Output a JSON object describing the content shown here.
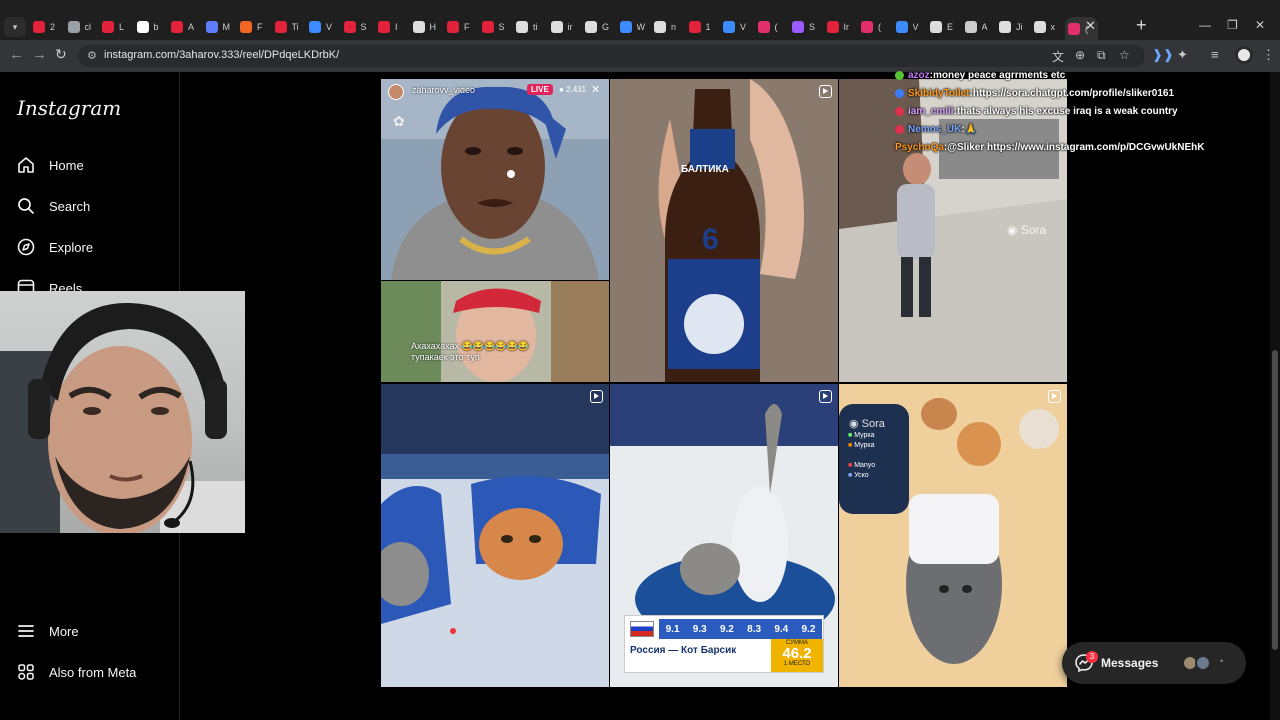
{
  "browser": {
    "tabs": [
      {
        "title": "2",
        "color": "#e3223c"
      },
      {
        "title": "cl",
        "color": "#9aa0a6"
      },
      {
        "title": "L",
        "color": "#e3223c"
      },
      {
        "title": "b",
        "color": "#ffffff"
      },
      {
        "title": "A",
        "color": "#e3223c"
      },
      {
        "title": "M",
        "color": "#5c7cfa"
      },
      {
        "title": "F",
        "color": "#f26522"
      },
      {
        "title": "Ti",
        "color": "#e3223c"
      },
      {
        "title": "V",
        "color": "#3d8bff"
      },
      {
        "title": "S",
        "color": "#e3223c"
      },
      {
        "title": "I",
        "color": "#e3223c"
      },
      {
        "title": "H",
        "color": "#dddddd"
      },
      {
        "title": "F",
        "color": "#e3223c"
      },
      {
        "title": "S",
        "color": "#e3223c"
      },
      {
        "title": "ti",
        "color": "#dddddd"
      },
      {
        "title": "ir",
        "color": "#dddddd"
      },
      {
        "title": "G",
        "color": "#dddddd"
      },
      {
        "title": "W",
        "color": "#3d8bff"
      },
      {
        "title": "n",
        "color": "#dddddd"
      },
      {
        "title": "1",
        "color": "#e3223c"
      },
      {
        "title": "V",
        "color": "#3d8bff"
      },
      {
        "title": "(",
        "color": "#e1306c"
      },
      {
        "title": "S",
        "color": "#9b59ff"
      },
      {
        "title": "Ir",
        "color": "#e3223c"
      },
      {
        "title": "(",
        "color": "#e1306c"
      },
      {
        "title": "V",
        "color": "#3d8bff"
      },
      {
        "title": "E",
        "color": "#dddddd"
      },
      {
        "title": "A",
        "color": "#cccccc"
      },
      {
        "title": "Ji",
        "color": "#dddddd"
      },
      {
        "title": "x",
        "color": "#dddddd"
      },
      {
        "title": "(",
        "color": "#e1306c"
      }
    ],
    "new_tab": "+",
    "url": "instagram.com/3aharov.333/reel/DPdqeLKDrbK/"
  },
  "sidebar": {
    "logo": "Instagram",
    "items": [
      {
        "label": "Home",
        "icon": "home-icon"
      },
      {
        "label": "Search",
        "icon": "search-icon"
      },
      {
        "label": "Explore",
        "icon": "compass-icon"
      },
      {
        "label": "Reels",
        "icon": "reels-icon"
      }
    ],
    "bottom": [
      {
        "label": "More",
        "icon": "menu-icon"
      },
      {
        "label": "Also from Meta",
        "icon": "meta-icon"
      }
    ]
  },
  "reels": {
    "tile1": {
      "user": "zaharovv_video",
      "live": "LIVE",
      "viewers": "2,431",
      "caption": "Ахахахахах 😂😂😂😂😂😂 тупакаек это туп"
    },
    "tile2": {
      "brand": "БАЛТИКА",
      "number": "6"
    },
    "tile3": {
      "watermark": "Sora"
    },
    "tile6": {
      "watermark": "Sora",
      "list": [
        "Мурка",
        "Мурка",
        "Manyo",
        "Уско"
      ]
    },
    "tile5": {
      "scores": [
        "9.1",
        "9.3",
        "9.2",
        "8.3",
        "9.4",
        "9.2"
      ],
      "label": "Россия — Кот Барсик",
      "total_label": "СУММА",
      "total": "46.2",
      "place": "1 МЕСТО"
    }
  },
  "chat": [
    {
      "user": "azoz",
      "user_color": "#c678ff",
      "badge": "#57c437",
      "text": "money peace agrrments etc"
    },
    {
      "user": "SkibidyToilet",
      "user_color": "#ff9a1f",
      "badge": "#3b7bff",
      "text": "https://sora.chatgpt.com/profile/sliker0161"
    },
    {
      "user": "iam_cmiii",
      "user_color": "#d9a0ff",
      "badge": "#e0304b",
      "text": "thats always his excuse iraq is a weak country"
    },
    {
      "user": "Nemos_UK",
      "user_color": "#7aa6ff",
      "badge": "#e0304b",
      "text": "🙏"
    },
    {
      "user": "PsychoQa",
      "user_color": "#ff9a1f",
      "badge": "",
      "text": "@Sliker https://www.instagram.com/p/DCGvwUkNEhK"
    }
  ],
  "messages": {
    "label": "Messages",
    "badge": "3"
  }
}
